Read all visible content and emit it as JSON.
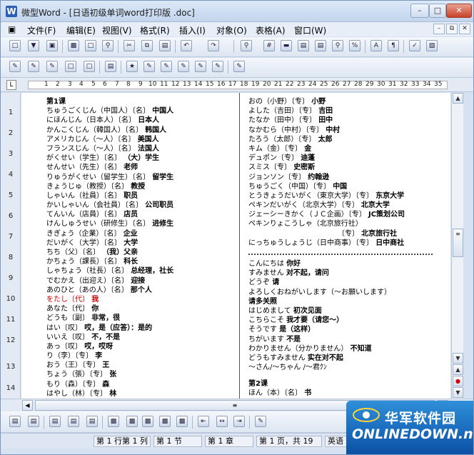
{
  "window": {
    "title": "微型Word - [日语初级单词word打印版 .doc]",
    "app_icon": "W"
  },
  "menu": [
    "文件(F)",
    "编辑(E)",
    "视图(V)",
    "格式(R)",
    "插入(I)",
    "对象(O)",
    "表格(A)",
    "窗口(W)"
  ],
  "ruler": {
    "corner": "L",
    "numbers": [
      "1",
      "2",
      "3",
      "4",
      "5",
      "6",
      "7",
      "8",
      "9",
      "10",
      "11",
      "12",
      "13",
      "14",
      "15",
      "16",
      "17",
      "18",
      "19",
      "20",
      "21",
      "22",
      "23",
      "24",
      "25",
      "26",
      "27",
      "28",
      "29",
      "30",
      "31",
      "32",
      "33",
      "34",
      "35"
    ]
  },
  "vruler_numbers": [
    "1",
    "2",
    "3",
    "4",
    "5",
    "6",
    "7",
    "8",
    "9",
    "10",
    "11",
    "12",
    "13",
    "14"
  ],
  "col1": [
    {
      "t": "第1课",
      "s": "bold"
    },
    {
      "t": "ちゅうごくじん（中国人）〔名〕",
      "b": "中国人"
    },
    {
      "t": "にほんじん（日本人）〔名〕",
      "b": "日本人"
    },
    {
      "t": "かんこくじん（韓国人）〔名〕",
      "b": "韩国人"
    },
    {
      "t": "アメリカじん（～人）〔名〕",
      "b": "美国人"
    },
    {
      "t": "フランスじん（～人）〔名〕",
      "b": "法国人"
    },
    {
      "t": "がくせい（学生）〔名〕",
      "b": "（大）学生"
    },
    {
      "t": "せんせい（先生）〔名〕",
      "b": "老师"
    },
    {
      "t": "りゅうがくせい（留学生）〔名〕",
      "b": "留学生"
    },
    {
      "t": "きょうじゅ（教授）〔名〕",
      "b": "教授"
    },
    {
      "t": "しゃいん（社員）〔名〕",
      "b": "职员"
    },
    {
      "t": "かいしゃいん（会社員）〔名〕",
      "b": "公司职员"
    },
    {
      "t": "てんいん（店員）〔名〕",
      "b": "店员"
    },
    {
      "t": "けんしゅうせい（研修生）〔名〕",
      "b": "进修生"
    },
    {
      "t": "きぎょう（企業）〔名〕",
      "b": "企业"
    },
    {
      "t": "だいがく（大学）〔名〕",
      "b": "大学"
    },
    {
      "t": "ちち（父）〔名〕",
      "b": "（我）父亲"
    },
    {
      "t": "かちょう（課長）〔名〕",
      "b": "科长"
    },
    {
      "t": "しゃちょう（社長）〔名〕",
      "b": "总经理，社长"
    },
    {
      "t": "でむかえ（出迎え）〔名〕",
      "b": "迎接"
    },
    {
      "t": "あのひと（あの人）〔名〕",
      "b": "那个人"
    },
    {
      "t": "をたし〔代〕",
      "b": "我",
      "s": "red"
    },
    {
      "t": "あなた〔代〕",
      "b": "你"
    },
    {
      "t": "どうも〔副〕",
      "b": "非常，很"
    },
    {
      "t": "はい〔叹〕",
      "b": "哎，是（应答）：是的"
    },
    {
      "t": "いいえ〔叹〕",
      "b": "不，不是"
    },
    {
      "t": "あっ〔叹〕",
      "b": "哎，哎呀"
    },
    {
      "t": "り（李）〔专〕",
      "b": "李"
    },
    {
      "t": "おう（王）〔专〕",
      "b": "王"
    },
    {
      "t": "ちょう（張）〔专〕",
      "b": "张"
    },
    {
      "t": "もり（森）〔专〕",
      "b": "森"
    },
    {
      "t": "はやし（林）〔专〕",
      "b": "林"
    }
  ],
  "col2_a": [
    {
      "t": "おの（小野）〔专〕",
      "b": "小野"
    },
    {
      "t": "よした（吉田）〔专〕",
      "b": "吉田"
    },
    {
      "t": "たなか（田中）〔专〕",
      "b": "田中"
    },
    {
      "t": "なかむら（中村）〔专〕",
      "b": "中村"
    },
    {
      "t": "たろう（太郎）〔专〕",
      "b": "太郎"
    },
    {
      "t": "キム（金）〔专〕",
      "b": "金"
    },
    {
      "t": "デュポン〔专〕",
      "b": "迪蓬"
    },
    {
      "t": "スミス〔专〕",
      "b": "史密斯"
    },
    {
      "t": "ジョンソン〔专〕",
      "b": "约翰逊"
    },
    {
      "t": "ちゅうごく（中国）〔专〕",
      "b": "中国"
    },
    {
      "t": "とうきょうだいがく（東京大学）〔专〕",
      "b": "东京大学"
    },
    {
      "t": "ペキンだいがく（北京大学）〔专〕",
      "b": "北京大学"
    },
    {
      "t": "ジェーシーきかく（ＪＣ企画）〔专〕",
      "b": "JC策划公司"
    },
    {
      "t": "ペキンりょこうしゃ（北京旅行社）",
      "b": ""
    },
    {
      "t": "　　　　　　　　　　　　　〔专〕",
      "b": "北京旅行社"
    },
    {
      "t": "にっちゅうしょうじ（日中商事）〔专〕",
      "b": "日中商社"
    }
  ],
  "col2_b": [
    {
      "t": "こんにちは",
      "b": "你好"
    },
    {
      "t": "すみません",
      "b": "对不起，请问"
    },
    {
      "t": "どうぞ",
      "b": "请"
    },
    {
      "t": "よろしくおねがいします（～お願いします）",
      "b": ""
    },
    {
      "t": "",
      "b": "请多关照"
    },
    {
      "t": "はじめまして",
      "b": "初次见面"
    },
    {
      "t": "こちらこそ",
      "b": "我才要（请您～）"
    },
    {
      "t": "そうです",
      "b": "是（这样）"
    },
    {
      "t": "ちがいます",
      "b": "不是"
    },
    {
      "t": "わかりません（分かりません）",
      "b": "不知道"
    },
    {
      "t": "どうもすみません",
      "b": "实在对不起"
    },
    {
      "t": "～さん/～ちゃん /～君ｸﾝ",
      "b": ""
    }
  ],
  "col2_c": [
    {
      "t": "第2课",
      "s": "bold"
    },
    {
      "t": "ほん（本）〔名〕",
      "b": "书"
    }
  ],
  "status": [
    "第 1 行第 1 列",
    "第 1 节",
    "第 1 章",
    "第 1 页，共 19",
    "英语"
  ],
  "watermark": {
    "cn": "华军软件园",
    "en": "ONLINEDOWN.net"
  }
}
